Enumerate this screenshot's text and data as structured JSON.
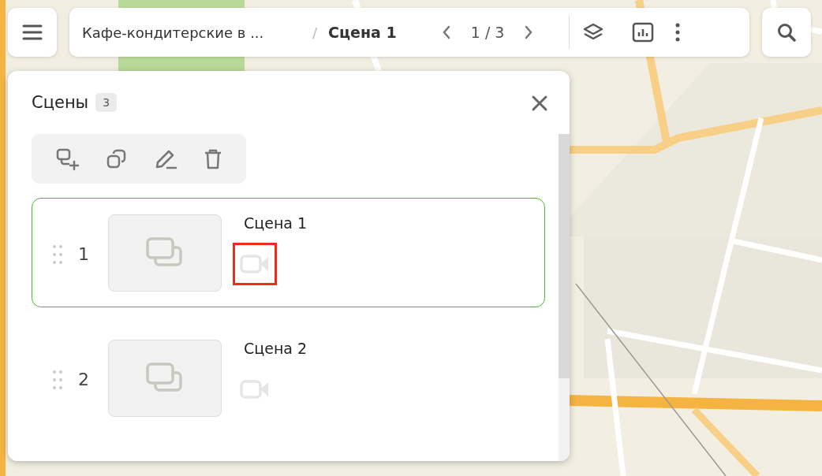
{
  "top_bar": {
    "project": "Кафе-кондитерские в ...",
    "separator": "/",
    "scene": "Сцена 1",
    "pager": "1 / 3"
  },
  "scenes_panel": {
    "title": "Сцены",
    "count": "3",
    "scenes": [
      {
        "number": "1",
        "title": "Сцена 1",
        "selected": true,
        "highlighted": true
      },
      {
        "number": "2",
        "title": "Сцена 2",
        "selected": false,
        "highlighted": false
      }
    ]
  }
}
